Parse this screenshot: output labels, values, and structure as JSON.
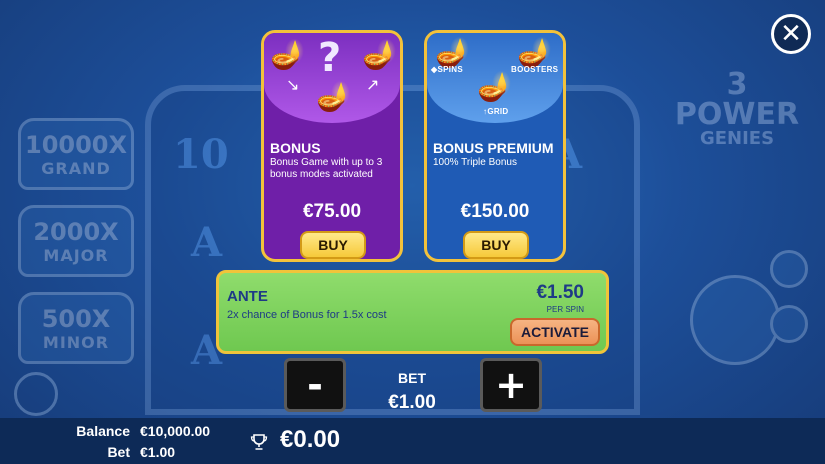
{
  "close": {
    "icon": "close-icon"
  },
  "background": {
    "jackpots": [
      {
        "value": "10000X",
        "name": "GRAND"
      },
      {
        "value": "2000X",
        "name": "MAJOR"
      },
      {
        "value": "500X",
        "name": "MINOR"
      }
    ],
    "logo": {
      "line1": "3 POWER",
      "line2": "GENIES"
    },
    "reel_symbols": [
      "10",
      "A",
      "A",
      "A"
    ]
  },
  "cards": [
    {
      "title": "BONUS",
      "description": "Bonus Game with up to 3 bonus modes activated",
      "price": "€75.00",
      "buy_label": "BUY",
      "art_mark": "?"
    },
    {
      "title": "BONUS PREMIUM",
      "description": "100% Triple Bonus",
      "price": "€150.00",
      "buy_label": "BUY",
      "art_labels": {
        "spins": "SPINS",
        "boosters": "BOOSTERS",
        "grid": "GRID"
      }
    }
  ],
  "ante": {
    "title": "ANTE",
    "description": "2x chance of Bonus for 1.5x cost",
    "price": "€1.50",
    "per": "PER SPIN",
    "activate_label": "ACTIVATE"
  },
  "bet": {
    "label": "BET",
    "value": "€1.00",
    "decrease_label": "-",
    "increase_label": "+"
  },
  "bottom_bar": {
    "balance_label": "Balance",
    "balance_value": "€10,000.00",
    "bet_label": "Bet",
    "bet_value": "€1.00",
    "win_value": "€0.00"
  },
  "colors": {
    "bonus_card": "#6f1fa8",
    "premium_card": "#1f5bb5",
    "gold_border": "#f3c23b",
    "ante_panel": "#7fd25e",
    "buy_button": "#f6c93a",
    "activate_button": "#ec9257"
  }
}
